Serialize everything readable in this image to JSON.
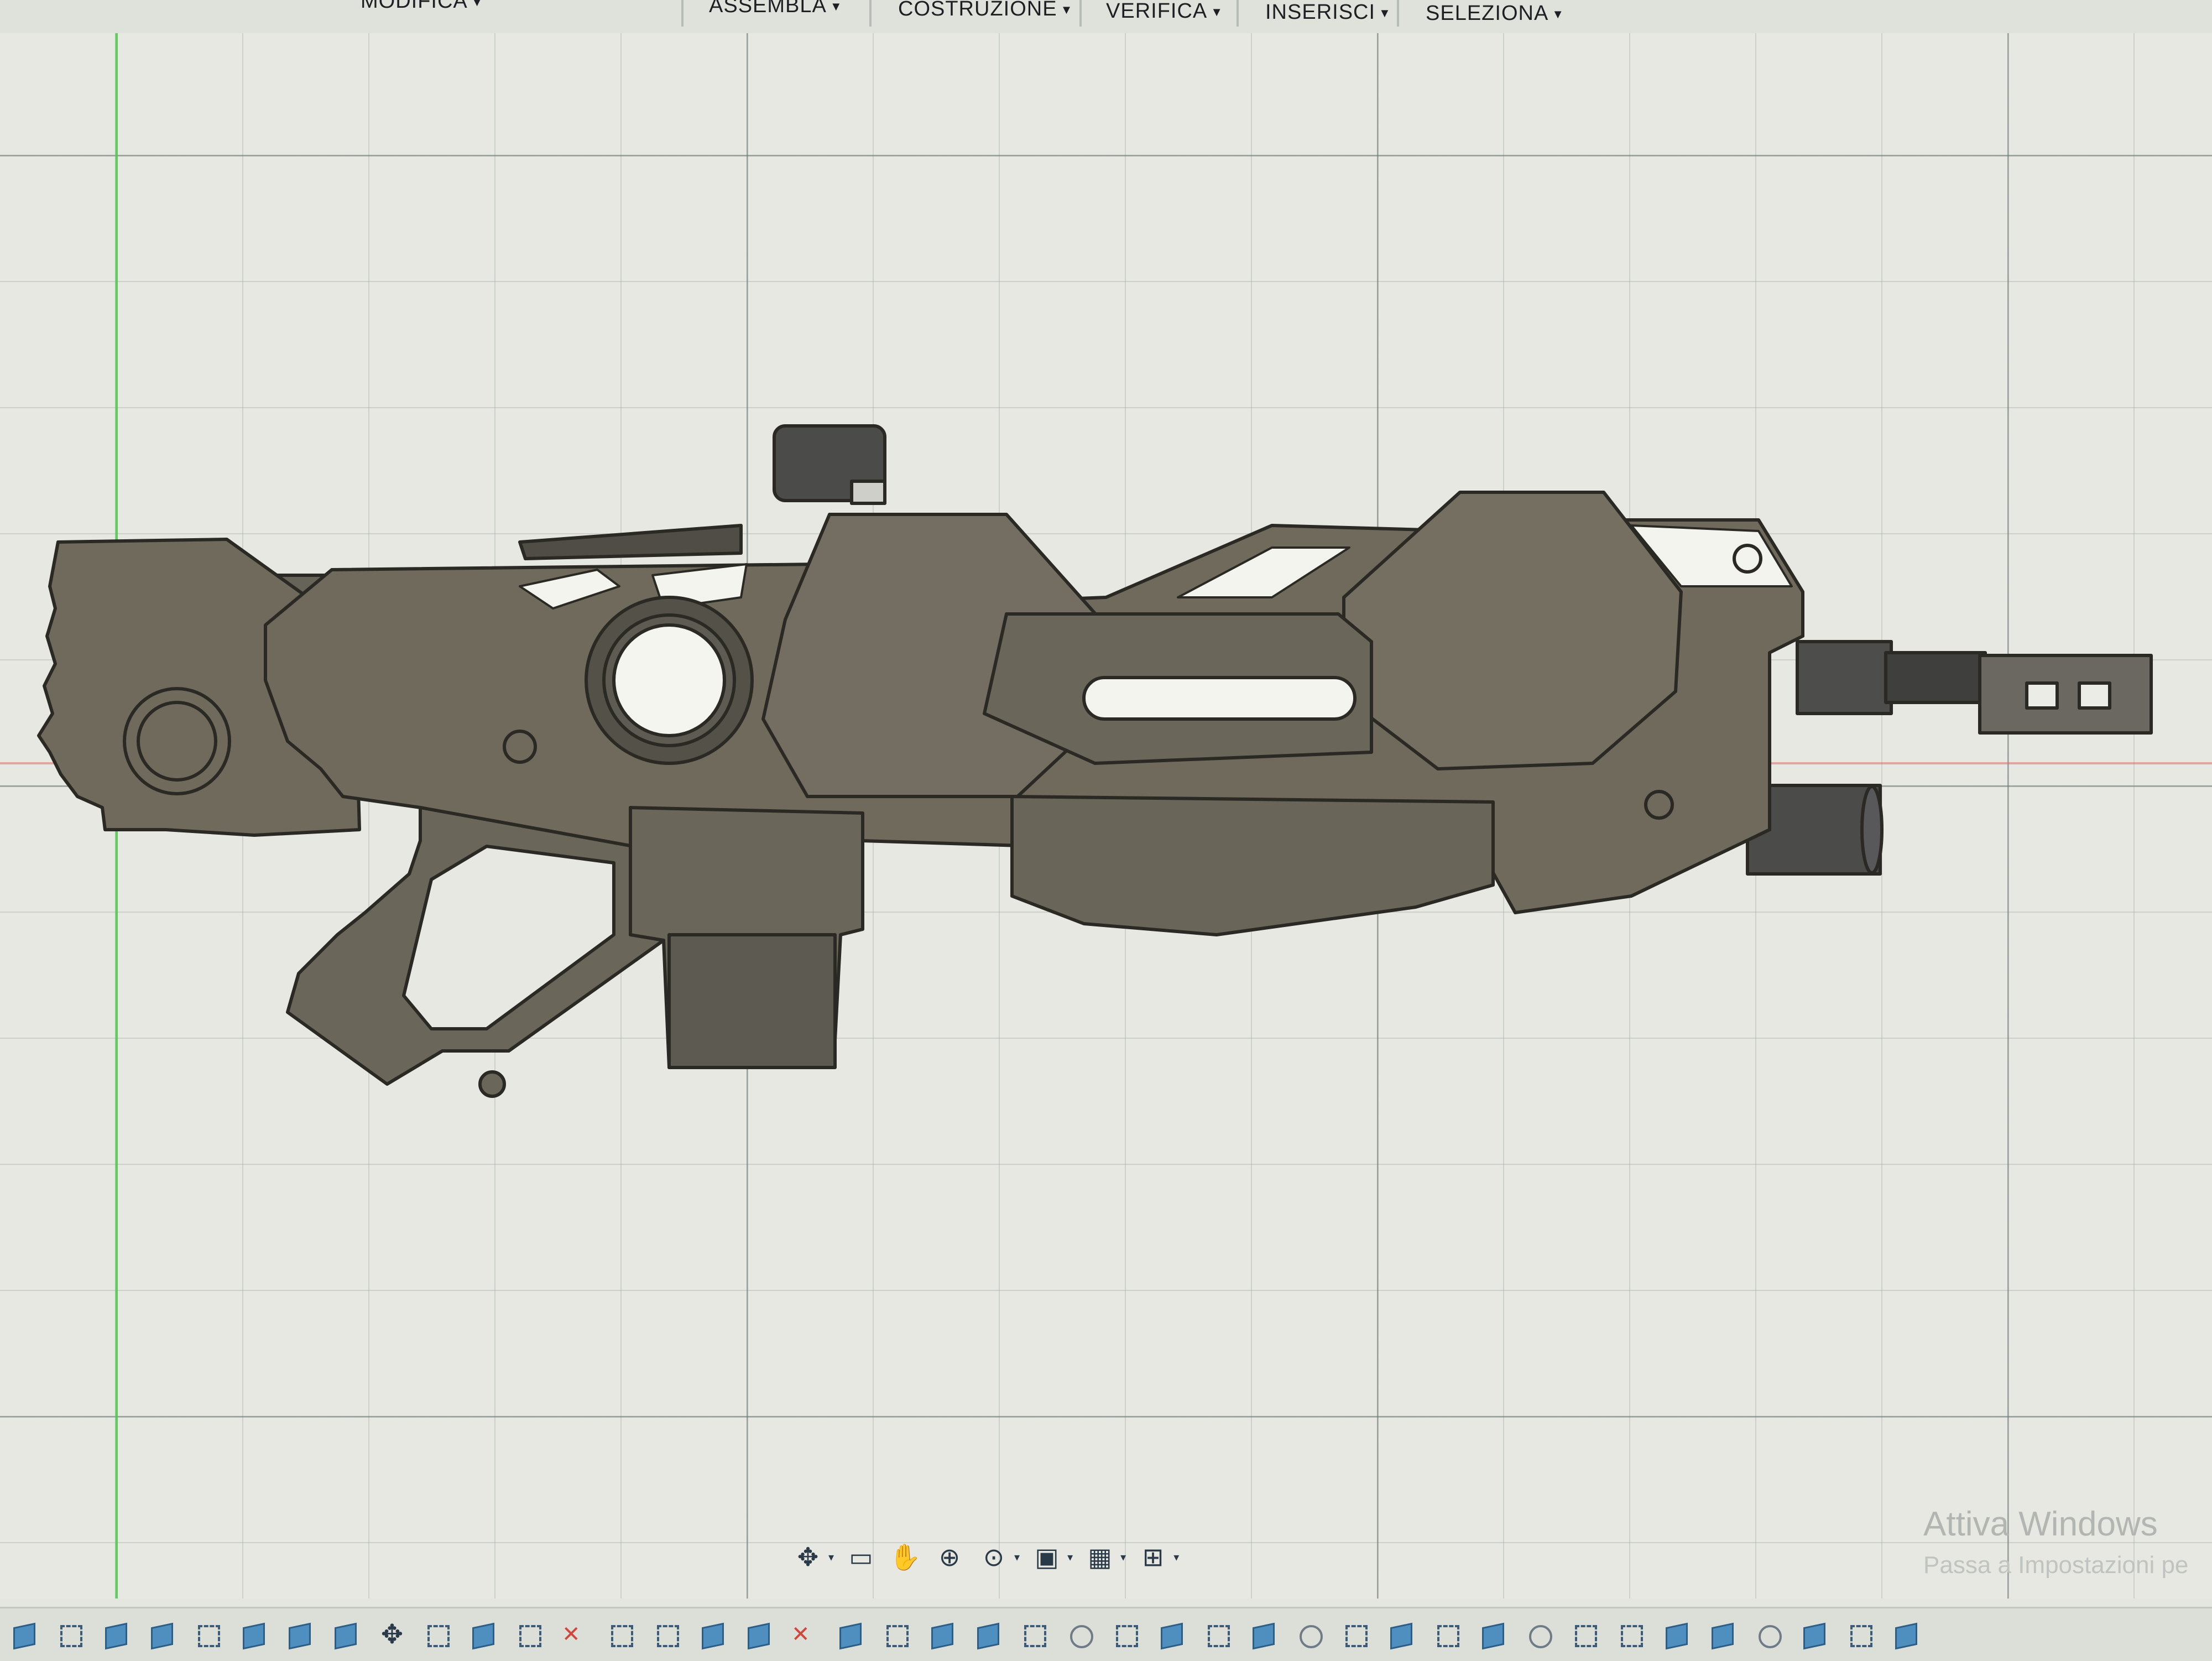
{
  "menu": {
    "items": [
      {
        "label": "MODIFICA"
      },
      {
        "label": "ASSEMBLA"
      },
      {
        "label": "COSTRUZIONE"
      },
      {
        "label": "VERIFICA"
      },
      {
        "label": "INSERISCI"
      },
      {
        "label": "SELEZIONA"
      }
    ]
  },
  "navbar": {
    "tools": [
      "orbit-icon",
      "look-at-icon",
      "pan-icon",
      "zoom-icon",
      "fit-icon",
      "display-settings-icon",
      "grid-icon",
      "viewports-icon"
    ]
  },
  "watermark": {
    "title": "Attiva Windows",
    "subtitle": "Passa a Impostazioni pe"
  },
  "colors": {
    "model_body": "#6f6a5c",
    "model_edge": "#2a2924",
    "model_highlight": "#f4f4ef",
    "canvas": "#e6e8e1",
    "grid": "#6e7876"
  }
}
